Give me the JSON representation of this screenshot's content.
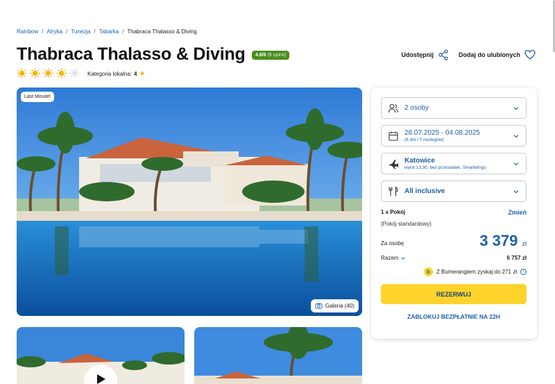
{
  "breadcrumb": {
    "items": [
      "Rainbow",
      "Afryka",
      "Tunezja",
      "Tabarka"
    ],
    "current": "Thabraca Thalasso & Diving"
  },
  "hotel": {
    "name": "Thabraca Thalasso & Diving",
    "rating": "4.8/6",
    "rating_sub": "(6 opinii)",
    "suns_filled": 4,
    "suns_total": 5,
    "local_category_label": "Kategoria lokalna:",
    "local_category_value": "4"
  },
  "actions": {
    "share_label": "Udostępnij",
    "favorite_label": "Dodaj do ulubionych"
  },
  "photo": {
    "badge": "Last Minute!",
    "gallery_label": "Galeria (40)"
  },
  "booking": {
    "persons": "2 osoby",
    "dates": "28.07.2025 - 04.08.2025",
    "dates_sub": "(8 dni / 7 noclegów)",
    "departure": "Katowice",
    "departure_sub": "wylot 13:30, bez przesiadek, Smartwings",
    "board": "All inclusive",
    "room_label": "1 x Pokój",
    "room_type": "(Pokój standardowy)",
    "change_label": "Zmień",
    "per_person_label": "Za osobę",
    "price": "3 379",
    "currency": "zł",
    "total_label": "Razem",
    "total_value": "6 757 zł",
    "bumerang_text": "Z Bumerangiem zyskaj do 271 zł",
    "reserve_label": "REZERWUJ",
    "block_label": "ZABLOKUJ BEZPŁATNIE NA 22H"
  },
  "colors": {
    "brand_blue": "#1f5fa8",
    "accent_yellow": "#fed42c",
    "rating_green": "#4a8d1f"
  }
}
